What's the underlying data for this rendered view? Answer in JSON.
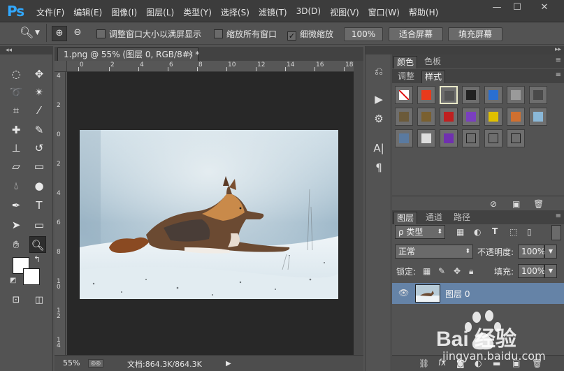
{
  "app": {
    "logo": "Ps"
  },
  "menu": [
    "文件(F)",
    "编辑(E)",
    "图像(I)",
    "图层(L)",
    "类型(Y)",
    "选择(S)",
    "滤镜(T)",
    "3D(D)",
    "视图(V)",
    "窗口(W)",
    "帮助(H)"
  ],
  "window_controls": {
    "minimize": "—",
    "restore": "☐",
    "close": "✕"
  },
  "options": {
    "zoom_tool_icon": "zoom-icon",
    "resize_windows_label": "调整窗口大小以满屏显示",
    "resize_windows_checked": false,
    "zoom_all_windows_label": "缩放所有窗口",
    "zoom_all_windows_checked": false,
    "scrubby_zoom_label": "细微缩放",
    "scrubby_zoom_checked": true,
    "btn_100": "100%",
    "btn_fit_screen": "适合屏幕",
    "btn_fill_screen": "填充屏幕"
  },
  "document": {
    "tab_title": "1.png @ 55% (图层 0, RGB/8#) *",
    "tab_close": "×",
    "ruler_top_labels": [
      "0",
      "2",
      "4",
      "6",
      "8",
      "10",
      "12",
      "14",
      "16",
      "18"
    ],
    "ruler_left_labels": [
      "4",
      "2",
      "0",
      "2",
      "4",
      "6",
      "8",
      "1 0",
      "1 2",
      "1 4"
    ]
  },
  "status": {
    "zoom": "55%",
    "doc_info": "文档:864.3K/864.3K",
    "arrow": "▶"
  },
  "panels": {
    "color_tabs": [
      "颜色",
      "色板"
    ],
    "adjust_tabs": [
      "调整",
      "样式"
    ],
    "layers_tabs": [
      "图层",
      "通道",
      "路径"
    ],
    "filter_kind": "ρ 类型",
    "blend_mode": "正常",
    "opacity_label": "不透明度:",
    "opacity_value": "100%",
    "lock_label": "锁定:",
    "fill_label": "填充:",
    "fill_value": "100%",
    "layer_name": "图层 0"
  },
  "watermark": {
    "text": "Bai 经验",
    "url": "jingyan.baidu.com"
  }
}
